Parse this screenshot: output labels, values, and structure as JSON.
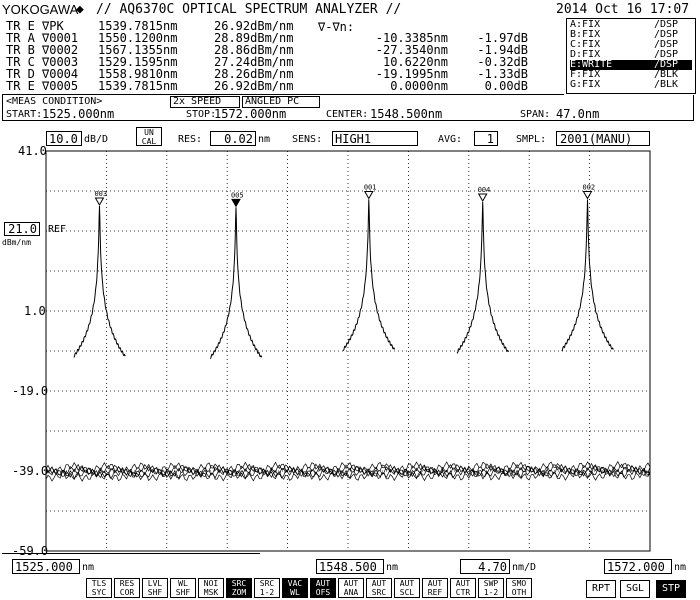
{
  "header": {
    "brand": "YOKOGAWA",
    "brand_mark": "diamond-logo",
    "title": "// AQ6370C OPTICAL SPECTRUM ANALYZER //",
    "datetime": "2014 Oct 16 17:07"
  },
  "markers": {
    "col_header": "∇-∇n:",
    "rows": [
      {
        "tr": "TR E",
        "name": "∇PK  ",
        "wl": "1539.7815nm",
        "pw": "26.92dBm/nm",
        "dwl": "",
        "dpw": ""
      },
      {
        "tr": "TR A",
        "name": "∇0001",
        "wl": "1550.1200nm",
        "pw": "28.89dBm/nm",
        "dwl": "-10.3385nm",
        "dpw": "-1.97dB"
      },
      {
        "tr": "TR B",
        "name": "∇0002",
        "wl": "1567.1355nm",
        "pw": "28.86dBm/nm",
        "dwl": "-27.3540nm",
        "dpw": "-1.94dB"
      },
      {
        "tr": "TR C",
        "name": "∇0003",
        "wl": "1529.1595nm",
        "pw": "27.24dBm/nm",
        "dwl": "10.6220nm",
        "dpw": "-0.32dB"
      },
      {
        "tr": "TR D",
        "name": "∇0004",
        "wl": "1558.9810nm",
        "pw": "28.26dBm/nm",
        "dwl": "-19.1995nm",
        "dpw": "-1.33dB"
      },
      {
        "tr": "TR E",
        "name": "∇0005",
        "wl": "1539.7815nm",
        "pw": "26.92dBm/nm",
        "dwl": "0.0000nm",
        "dpw": "0.00dB"
      }
    ]
  },
  "traces": [
    {
      "name": "A:FIX",
      "mode": "/DSP",
      "active": false
    },
    {
      "name": "B:FIX",
      "mode": "/DSP",
      "active": false
    },
    {
      "name": "C:FIX",
      "mode": "/DSP",
      "active": false
    },
    {
      "name": "D:FIX",
      "mode": "/DSP",
      "active": false
    },
    {
      "name": "E:WRITE",
      "mode": "/DSP",
      "active": true
    },
    {
      "name": "F:FIX",
      "mode": "/BLK",
      "active": false
    },
    {
      "name": "G:FIX",
      "mode": "/BLK",
      "active": false
    }
  ],
  "meas": {
    "label": "<MEAS CONDITION>",
    "speed": "2x SPEED",
    "angled": "ANGLED PC",
    "start_label": "START:",
    "start": "1525.000nm",
    "stop_label": "STOP:",
    "stop": "1572.000nm",
    "center_label": "CENTER:",
    "center": "1548.500nm",
    "span_label": "SPAN:",
    "span": "47.0nm"
  },
  "settings": {
    "dbd": "10.0",
    "dbd_unit": "dB/D",
    "uncal1": "UN",
    "uncal2": "CAL",
    "res_label": "RES:",
    "res": "0.02",
    "res_unit": "nm",
    "sens_label": "SENS:",
    "sens": "HIGH1",
    "avg_label": "AVG:",
    "avg": "1",
    "smpl_label": "SMPL:",
    "smpl": "2001(MANU)"
  },
  "axis": {
    "y_ticks": [
      "41.0",
      "1.0",
      "-19.0",
      "-39.0",
      "-59.0"
    ],
    "ref_value": "21.0",
    "ref_label": "REF",
    "ref_unit": "dBm/nm",
    "x_start": "1525.000",
    "x_center": "1548.500",
    "x_stop": "1572.000",
    "x_unit": "nm",
    "x_div": "4.70",
    "x_div_unit": "nm/D"
  },
  "chart_data": {
    "type": "line",
    "xlim": [
      1525.0,
      1572.0
    ],
    "ylim": [
      -59.0,
      41.0
    ],
    "ylabel": "dBm/nm",
    "grid": true,
    "peaks": [
      {
        "label": "003",
        "x": 1529.1595,
        "y": 27.24
      },
      {
        "label": "005",
        "x": 1539.7815,
        "y": 26.92
      },
      {
        "label": "001",
        "x": 1550.12,
        "y": 28.89
      },
      {
        "label": "004",
        "x": 1558.981,
        "y": 28.26
      },
      {
        "label": "002",
        "x": 1567.1355,
        "y": 28.86
      }
    ],
    "noise_floor": -39.0
  },
  "buttons": [
    {
      "l1": "TLS",
      "l2": "SYC",
      "on": false
    },
    {
      "l1": "RES",
      "l2": "COR",
      "on": false
    },
    {
      "l1": "LVL",
      "l2": "SHF",
      "on": false
    },
    {
      "l1": "WL",
      "l2": "SHF",
      "on": false
    },
    {
      "l1": "NOI",
      "l2": "MSK",
      "on": false
    },
    {
      "l1": "SRC",
      "l2": "ZOM",
      "on": true
    },
    {
      "l1": "SRC",
      "l2": "1-2",
      "on": false
    },
    {
      "l1": "VAC",
      "l2": "WL",
      "on": true
    },
    {
      "l1": "AUT",
      "l2": "OFS",
      "on": true
    },
    {
      "l1": "AUT",
      "l2": "ANA",
      "on": false
    },
    {
      "l1": "AUT",
      "l2": "SRC",
      "on": false
    },
    {
      "l1": "AUT",
      "l2": "SCL",
      "on": false
    },
    {
      "l1": "AUT",
      "l2": "REF",
      "on": false
    },
    {
      "l1": "AUT",
      "l2": "CTR",
      "on": false
    },
    {
      "l1": "SWP",
      "l2": "1-2",
      "on": false
    },
    {
      "l1": "SMO",
      "l2": "OTH",
      "on": false
    }
  ],
  "run_buttons": [
    {
      "label": "RPT",
      "on": false
    },
    {
      "label": "SGL",
      "on": false
    },
    {
      "label": "STP",
      "on": true
    }
  ]
}
